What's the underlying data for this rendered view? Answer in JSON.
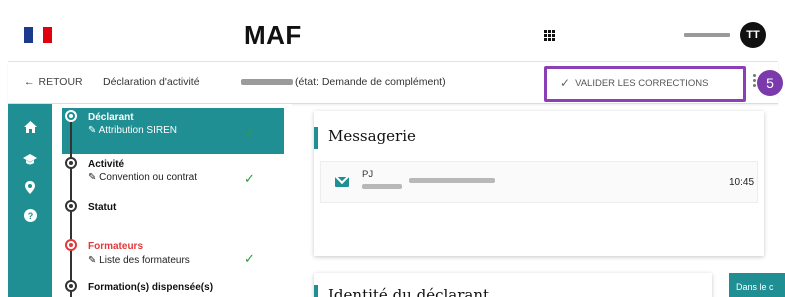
{
  "header": {
    "app_title": "MAF",
    "user_initials": "TT",
    "user_name_redacted": true,
    "icons": {
      "flag": "french-flag-logo",
      "apps": "grid-apps-icon"
    }
  },
  "subbar": {
    "back_label": "RETOUR",
    "breadcrumb": "Déclaration d'activité",
    "status": "(état: Demande de complément)",
    "validate_label": "VALIDER LES CORRECTIONS",
    "step_badge": "5"
  },
  "rail": {
    "icons": [
      "home-icon",
      "graduation-cap-icon",
      "location-pin-icon",
      "help-icon"
    ]
  },
  "steps": [
    {
      "title": "Déclarant",
      "sub": "Attribution SIREN",
      "checked": true,
      "state": "active"
    },
    {
      "title": "Activité",
      "sub": "Convention ou contrat",
      "checked": true,
      "state": "normal"
    },
    {
      "title": "Statut",
      "sub": "",
      "checked": false,
      "state": "normal"
    },
    {
      "title": "Formateurs",
      "sub": "Liste des formateurs",
      "checked": true,
      "state": "error"
    },
    {
      "title": "Formation(s) dispensée(s)",
      "sub": "",
      "checked": false,
      "state": "normal"
    }
  ],
  "messaging": {
    "title": "Messagerie",
    "message": {
      "from": "PJ",
      "time": "10:45"
    }
  },
  "identity_card": {
    "title": "Identité du déclarant"
  },
  "side_tab": {
    "label": "Dans le c"
  },
  "colors": {
    "teal": "#1f8f93",
    "purple": "#7a3aab",
    "error_red": "#e03a3a",
    "check_green": "#2e9e3c"
  }
}
